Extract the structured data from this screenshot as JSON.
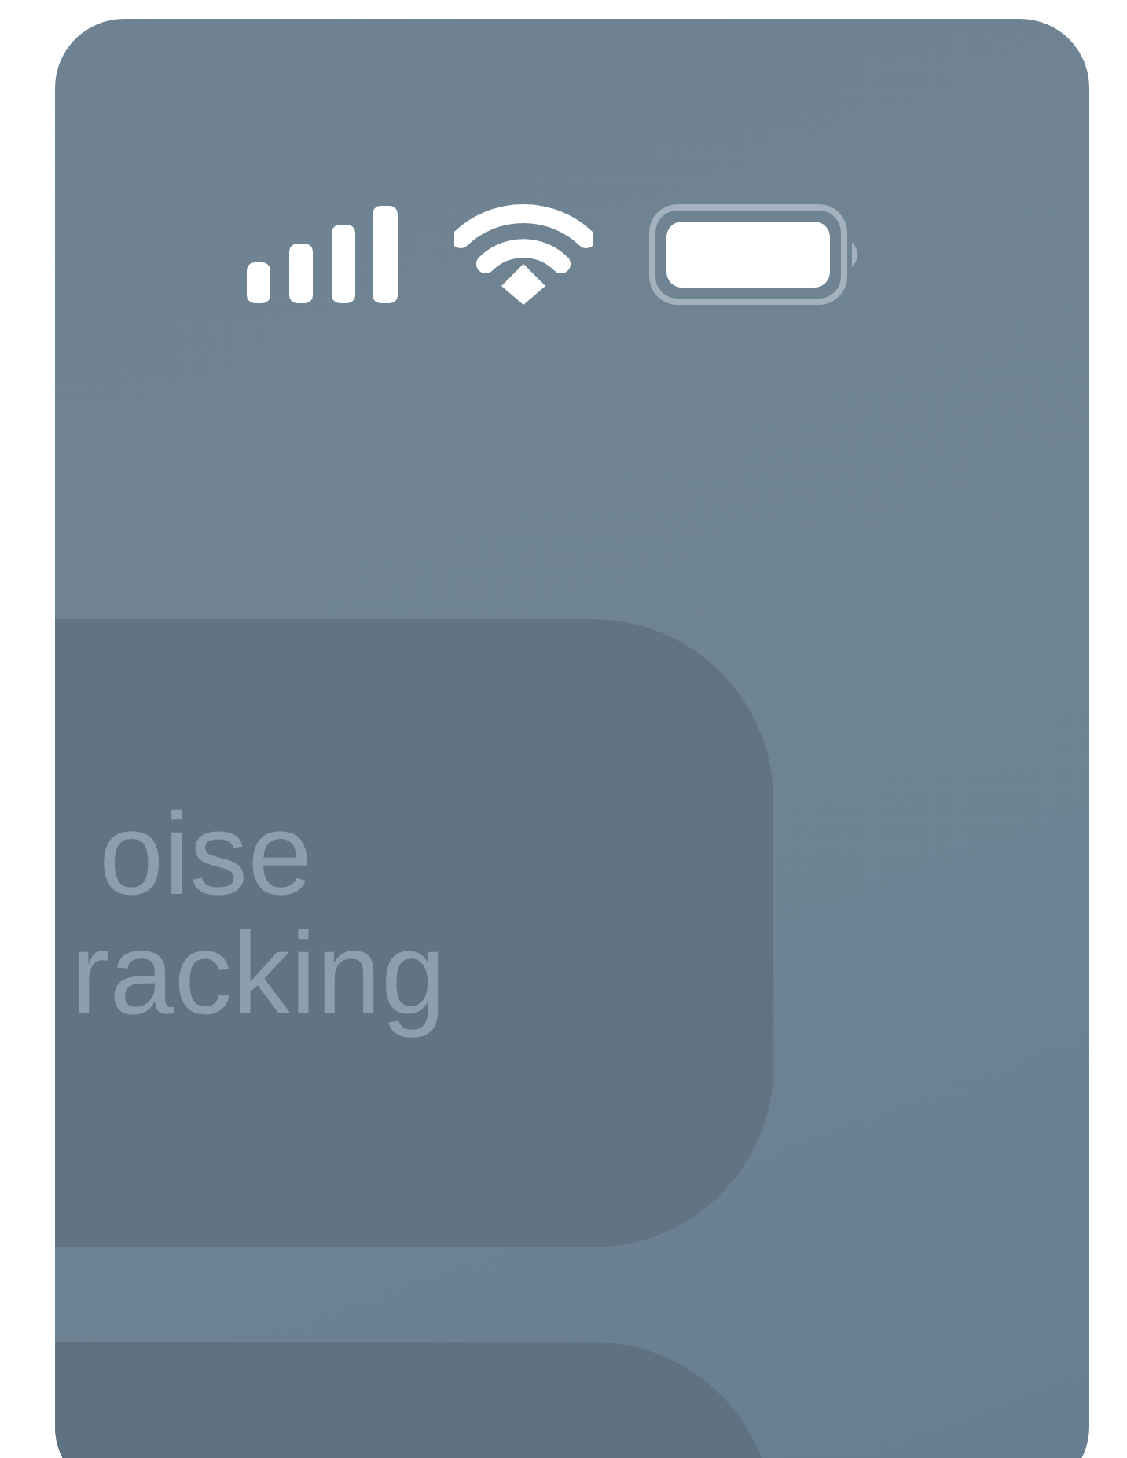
{
  "card": {
    "title_lines": [
      "oise",
      "racking"
    ]
  }
}
